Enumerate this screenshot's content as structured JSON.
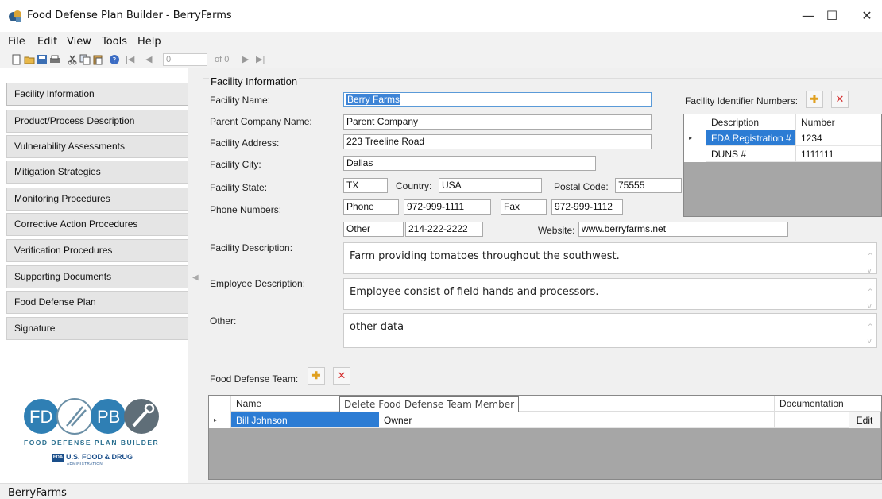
{
  "window": {
    "title": "Food Defense Plan Builder - BerryFarms",
    "min": "—",
    "max": "☐",
    "close": "✕"
  },
  "menu": [
    "File",
    "Edit",
    "View",
    "Tools",
    "Help"
  ],
  "toolbar": {
    "page_value": "0",
    "page_of": "of 0",
    "nav_first": "|◀",
    "nav_prev": "◀",
    "nav_next": "▶",
    "nav_last": "▶|"
  },
  "sidebar": {
    "items": [
      "Facility Information",
      "Product/Process Description",
      "Vulnerability Assessments",
      "Mitigation Strategies",
      "Monitoring Procedures",
      "Corrective Action Procedures",
      "Verification Procedures",
      "Supporting Documents",
      "Food Defense Plan",
      "Signature"
    ],
    "collapse_glyph": "◀",
    "logo": {
      "fd": "FD",
      "pb": "PB",
      "tagline": "FOOD DEFENSE PLAN BUILDER",
      "fda_badge": "FDA",
      "fda_name": "U.S. FOOD & DRUG",
      "fda_sub": "ADMINISTRATION"
    }
  },
  "facility": {
    "section_title": "Facility Information",
    "name_label": "Facility Name:",
    "name_value": "Berry Farms",
    "parent_label": "Parent Company Name:",
    "parent_value": "Parent Company",
    "address_label": "Facility Address:",
    "address_value": "223 Treeline Road",
    "city_label": "Facility City:",
    "city_value": "Dallas",
    "state_label": "Facility State:",
    "state_value": "TX",
    "country_label": "Country:",
    "country_value": "USA",
    "postal_label": "Postal Code:",
    "postal_value": "75555",
    "phones_label": "Phone Numbers:",
    "phone_type": "Phone",
    "phone_value": "972-999-1111",
    "fax_type": "Fax",
    "fax_value": "972-999-1112",
    "other_type": "Other",
    "other_value": "214-222-2222",
    "website_label": "Website:",
    "website_value": "www.berryfarms.net",
    "description_label": "Facility Description:",
    "description_value": "Farm providing tomatoes throughout the southwest.",
    "employee_label": "Employee Description:",
    "employee_value": "Employee consist of field hands and processors.",
    "other_label": "Other:",
    "other_text": "other data",
    "scroll_up": "^",
    "scroll_down": "v"
  },
  "identifiers": {
    "label": "Facility Identifier Numbers:",
    "add": "✚",
    "delete": "✕",
    "columns": [
      "Description",
      "Number"
    ],
    "rows": [
      {
        "description": "FDA Registration #",
        "number": "1234"
      },
      {
        "description": "DUNS #",
        "number": "1111111"
      }
    ],
    "row_marker": "▸"
  },
  "team": {
    "label": "Food Defense Team:",
    "add": "✚",
    "delete": "✕",
    "tooltip": "Delete Food Defense Team Member",
    "columns": [
      "Name",
      "Documentation"
    ],
    "rows": [
      {
        "name": "Bill Johnson",
        "role": "Owner",
        "action": "Edit"
      }
    ],
    "row_marker": "▸"
  },
  "status": {
    "text": "BerryFarms"
  }
}
